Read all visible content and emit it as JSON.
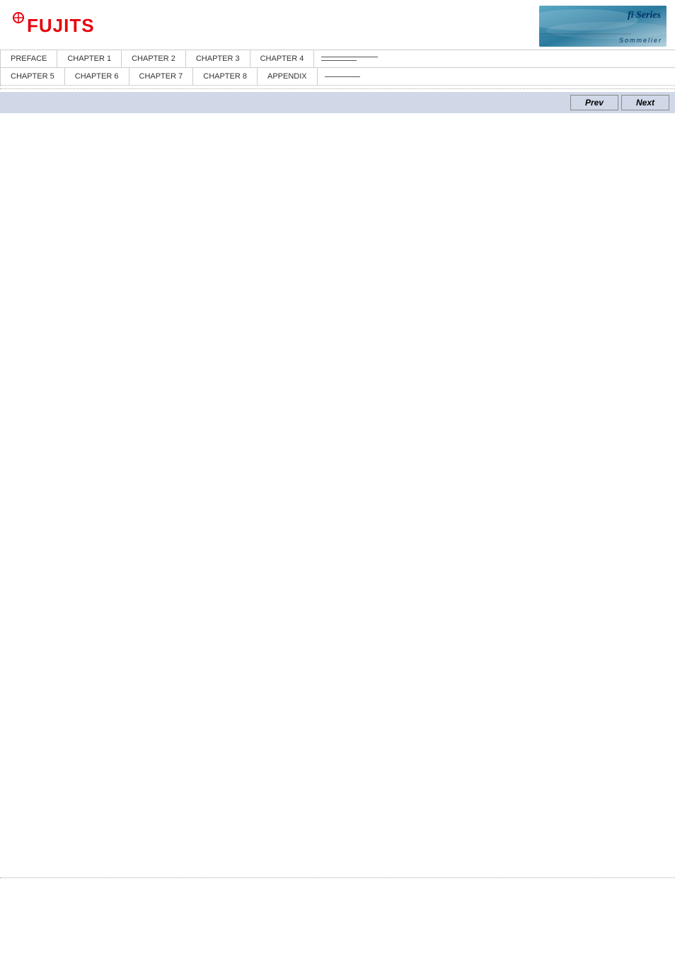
{
  "header": {
    "logo_alt": "FUJITSU",
    "fi_series_text": "fi Series",
    "fi_series_sub": "Sommelier"
  },
  "nav": {
    "row1": [
      {
        "label": "PREFACE",
        "id": "preface"
      },
      {
        "label": "CHAPTER 1",
        "id": "chapter1"
      },
      {
        "label": "CHAPTER 2",
        "id": "chapter2"
      },
      {
        "label": "CHAPTER 3",
        "id": "chapter3"
      },
      {
        "label": "CHAPTER 4",
        "id": "chapter4"
      }
    ],
    "row2": [
      {
        "label": "CHAPTER 5",
        "id": "chapter5"
      },
      {
        "label": "CHAPTER 6",
        "id": "chapter6"
      },
      {
        "label": "CHAPTER 7",
        "id": "chapter7"
      },
      {
        "label": "CHAPTER 8",
        "id": "chapter8"
      },
      {
        "label": "APPENDIX",
        "id": "appendix"
      }
    ]
  },
  "buttons": {
    "prev_label": "Prev",
    "next_label": "Next"
  }
}
